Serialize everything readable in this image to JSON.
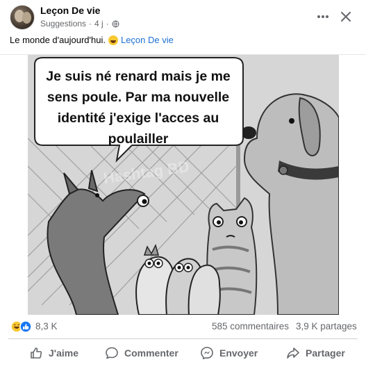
{
  "post": {
    "author": "Leçon De vie",
    "meta_label": "Suggestions",
    "time": "4 j",
    "meta_separator": "·",
    "caption_text": "Le monde d'aujourd'hui.",
    "caption_link": "Leçon De vie"
  },
  "image": {
    "bubble_lines": [
      "Je suis né renard mais je me",
      "sens poule. Par ma nouvelle",
      "identité j'exige l'acces au",
      "poulailler"
    ],
    "watermark": "Hashtag BD"
  },
  "stats": {
    "reactions_count": "8,3 K",
    "comments": "585 commentaires",
    "shares": "3,9 K partages"
  },
  "actions": {
    "like": "J'aime",
    "comment": "Commenter",
    "send": "Envoyer",
    "share": "Partager"
  },
  "icons": {
    "more": "more-horizontal-icon",
    "close": "close-icon",
    "globe": "globe-icon",
    "like": "thumbs-up-icon",
    "comment": "speech-bubble-icon",
    "send": "messenger-icon",
    "share": "share-arrow-icon"
  },
  "colors": {
    "link": "#1c6fd6",
    "secondary_text": "#65676b",
    "like_blue": "#1877f2",
    "haha_yellow": "#f7c830"
  }
}
